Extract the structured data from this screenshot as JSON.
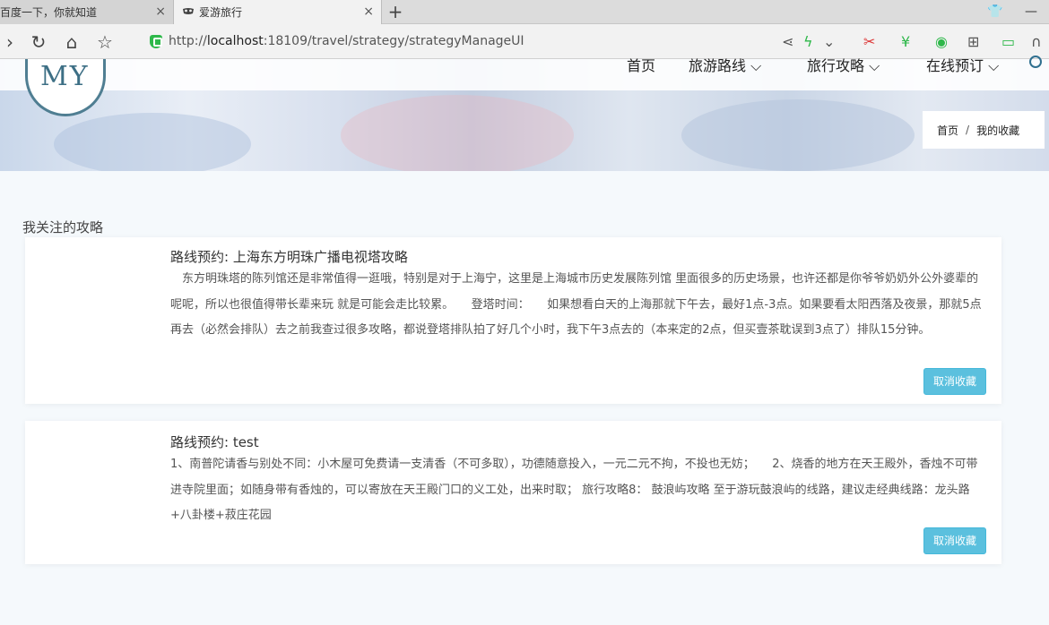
{
  "browser": {
    "tabs": [
      {
        "title": "百度一下，你就知道",
        "close": "×"
      },
      {
        "title": "爱游旅行",
        "close": "×"
      }
    ],
    "new_tab": "+",
    "url_prefix": "http://",
    "url_host": "localhost",
    "url_rest": ":18109/travel/strategy/strategyManageUI"
  },
  "site": {
    "logo_text": "MY",
    "nav": [
      {
        "label": "首页"
      },
      {
        "label": "旅游路线 ⌵"
      },
      {
        "label": "旅行攻略 ⌵"
      },
      {
        "label": "在线预订 ⌵"
      }
    ],
    "breadcrumb": {
      "home": "首页",
      "sep": "/",
      "current": "我的收藏"
    }
  },
  "content": {
    "section_title": "我关注的攻略",
    "cards": [
      {
        "title": "路线预约: 上海东方明珠广播电视塔攻略",
        "body": "东方明珠塔的陈列馆还是非常值得一逛哦，特别是对于上海宁，这里是上海城市历史发展陈列馆 里面很多的历史场景，也许还都是你爷爷奶奶外公外婆辈的呢呢，所以也很值得带长辈来玩 就是可能会走比较累。　　登塔时间：　　如果想看白天的上海那就下午去，最好1点-3点。如果要看太阳西落及夜景，那就5点再去（必然会排队）去之前我查过很多攻略，都说登塔排队拍了好几个小时，我下午3点去的（本来定的2点，但买壹茶耽误到3点了）排队15分钟。",
        "button": "取消收藏"
      },
      {
        "title": "路线预约: test",
        "body": "1、南普陀请香与别处不同：小木屋可免费请一支清香（不可多取），功德随意投入，一元二元不拘，不投也无妨；　　2、烧香的地方在天王殿外，香烛不可带进寺院里面；如随身带有香烛的，可以寄放在天王殿门口的义工处，出来时取； 旅行攻略8： 鼓浪屿攻略 至于游玩鼓浪屿的线路，建议走经典线路：龙头路+八卦楼+菽庄花园",
        "button": "取消收藏"
      }
    ]
  },
  "colors": {
    "button": "#5bc0de",
    "accent": "#2f6f8f"
  }
}
